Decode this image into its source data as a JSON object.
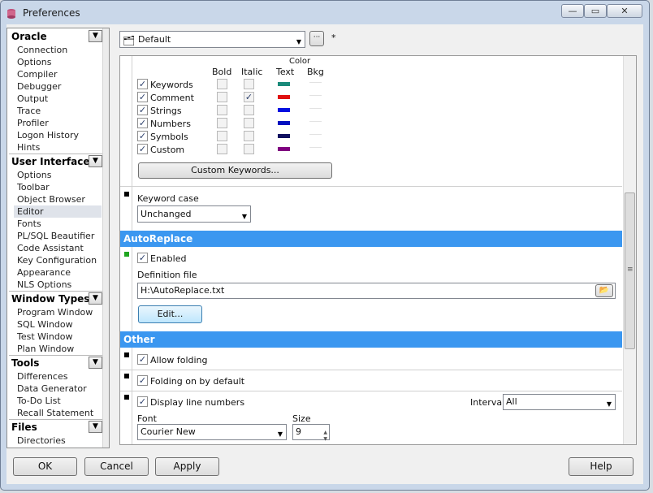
{
  "window": {
    "title": "Preferences",
    "min_label": "—",
    "max_label": "▭",
    "close_label": "✕"
  },
  "nav": {
    "groups": [
      {
        "title": "Oracle",
        "items": [
          "Connection",
          "Options",
          "Compiler",
          "Debugger",
          "Output",
          "Trace",
          "Profiler",
          "Logon History",
          "Hints"
        ]
      },
      {
        "title": "User Interface",
        "items": [
          "Options",
          "Toolbar",
          "Object Browser",
          "Editor",
          "Fonts",
          "PL/SQL Beautifier",
          "Code Assistant",
          "Key Configuration",
          "Appearance",
          "NLS Options"
        ]
      },
      {
        "title": "Window Types",
        "items": [
          "Program Window",
          "SQL Window",
          "Test Window",
          "Plan Window"
        ]
      },
      {
        "title": "Tools",
        "items": [
          "Differences",
          "Data Generator",
          "To-Do List",
          "Recall Statement"
        ]
      },
      {
        "title": "Files",
        "items": [
          "Directories"
        ]
      }
    ],
    "selected": "Editor"
  },
  "profile": {
    "value": "Default",
    "more_label": "···",
    "modified_marker": "*"
  },
  "syntax": {
    "headers": {
      "bold": "Bold",
      "italic": "Italic",
      "color": "Color",
      "text": "Text",
      "bkg": "Bkg"
    },
    "rows": [
      {
        "label": "Keywords",
        "enabled": true,
        "bold": false,
        "italic": false,
        "color": "#1a8a7a"
      },
      {
        "label": "Comment",
        "enabled": true,
        "bold": false,
        "italic": true,
        "color": "#e01010"
      },
      {
        "label": "Strings",
        "enabled": true,
        "bold": false,
        "italic": false,
        "color": "#0010e0"
      },
      {
        "label": "Numbers",
        "enabled": true,
        "bold": false,
        "italic": false,
        "color": "#0010c0"
      },
      {
        "label": "Symbols",
        "enabled": true,
        "bold": false,
        "italic": false,
        "color": "#101060"
      },
      {
        "label": "Custom",
        "enabled": true,
        "bold": false,
        "italic": false,
        "color": "#800080"
      }
    ],
    "custom_keywords_label": "Custom Keywords..."
  },
  "keyword_case": {
    "label": "Keyword case",
    "value": "Unchanged"
  },
  "autoreplace": {
    "title": "AutoReplace",
    "enabled_label": "Enabled",
    "definition_label": "Definition file",
    "definition_value": "H:\\AutoReplace.txt",
    "edit_label": "Edit..."
  },
  "other": {
    "title": "Other",
    "allow_folding": "Allow folding",
    "folding_default": "Folding on by default",
    "line_numbers": "Display line numbers",
    "interval_label": "Interval",
    "interval_value": "All",
    "font_label": "Font",
    "font_value": "Courier New",
    "size_label": "Size",
    "size_value": "9"
  },
  "footer": {
    "ok": "OK",
    "cancel": "Cancel",
    "apply": "Apply",
    "help": "Help"
  },
  "colors": {
    "section_bar": "#3b97f0",
    "selected_nav": "#dfe3ea"
  }
}
